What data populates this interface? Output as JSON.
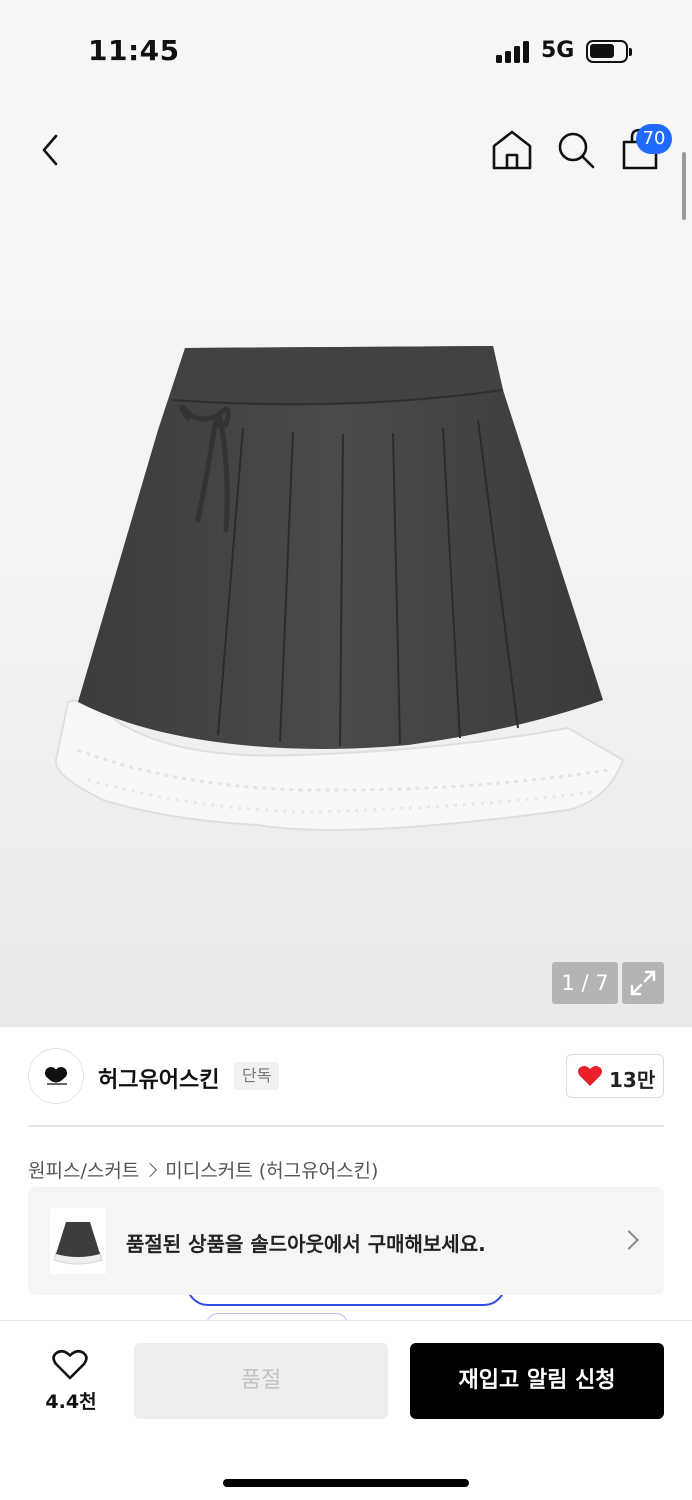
{
  "status_bar": {
    "time": "11:45",
    "network": "5G"
  },
  "header": {
    "back_icon": "chevron-left-icon",
    "home_icon": "home-icon",
    "search_icon": "search-icon",
    "cart_icon": "shopping-bag-icon",
    "cart_count": "70",
    "badge_color": "#1f6bff"
  },
  "gallery": {
    "image_subject": "grey pleated mini skirt with white lace hem",
    "counter": "1 / 7",
    "expand_icon": "expand-icon"
  },
  "brand": {
    "name": "허그유어스킨",
    "tag": "단독",
    "likes": "13만",
    "heart_color": "#e8202a"
  },
  "breadcrumb": {
    "items": [
      "원피스/스커트",
      "미디스커트 (허그유어스킨)"
    ]
  },
  "soldout_banner": {
    "text": "품절된 상품을 솔드아웃에서 구매해보세요."
  },
  "bottom_bar": {
    "wish_count": "4.4천",
    "soldout_label": "품절",
    "restock_label": "재입고 알림 신청"
  }
}
